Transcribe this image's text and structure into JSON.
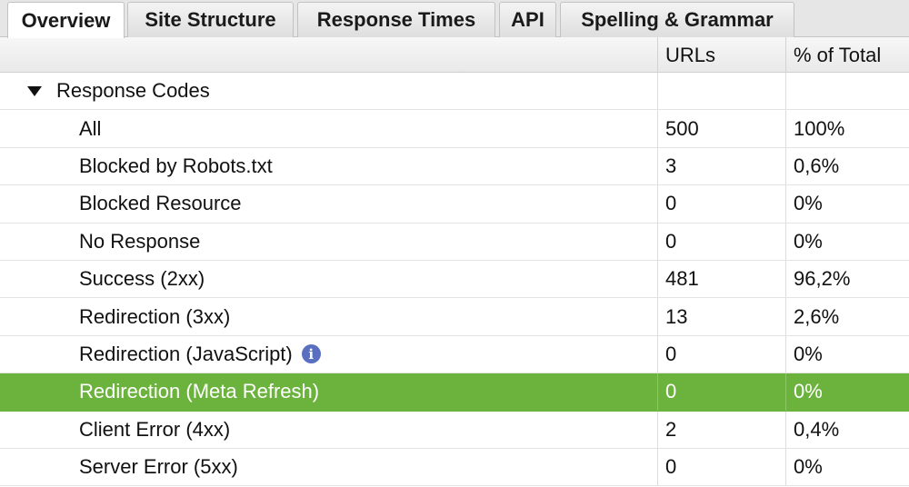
{
  "tabs": [
    {
      "label": "Overview",
      "active": true
    },
    {
      "label": "Site Structure",
      "active": false
    },
    {
      "label": "Response Times",
      "active": false
    },
    {
      "label": "API",
      "active": false
    },
    {
      "label": "Spelling & Grammar",
      "active": false
    }
  ],
  "columns": {
    "urls": "URLs",
    "pct": "% of Total"
  },
  "group": {
    "label": "Response Codes",
    "expanded": true
  },
  "rows": [
    {
      "label": "All",
      "urls": "500",
      "pct": "100%"
    },
    {
      "label": "Blocked by Robots.txt",
      "urls": "3",
      "pct": "0,6%"
    },
    {
      "label": "Blocked Resource",
      "urls": "0",
      "pct": "0%"
    },
    {
      "label": "No Response",
      "urls": "0",
      "pct": "0%"
    },
    {
      "label": "Success (2xx)",
      "urls": "481",
      "pct": "96,2%"
    },
    {
      "label": "Redirection (3xx)",
      "urls": "13",
      "pct": "2,6%"
    },
    {
      "label": "Redirection (JavaScript)",
      "urls": "0",
      "pct": "0%",
      "icon": "info-icon"
    },
    {
      "label": "Redirection (Meta Refresh)",
      "urls": "0",
      "pct": "0%",
      "selected": true
    },
    {
      "label": "Client Error (4xx)",
      "urls": "2",
      "pct": "0,4%"
    },
    {
      "label": "Server Error (5xx)",
      "urls": "0",
      "pct": "0%"
    }
  ],
  "colors": {
    "selected_row": "#6cb33e",
    "info_icon": "#5b6fc0"
  }
}
